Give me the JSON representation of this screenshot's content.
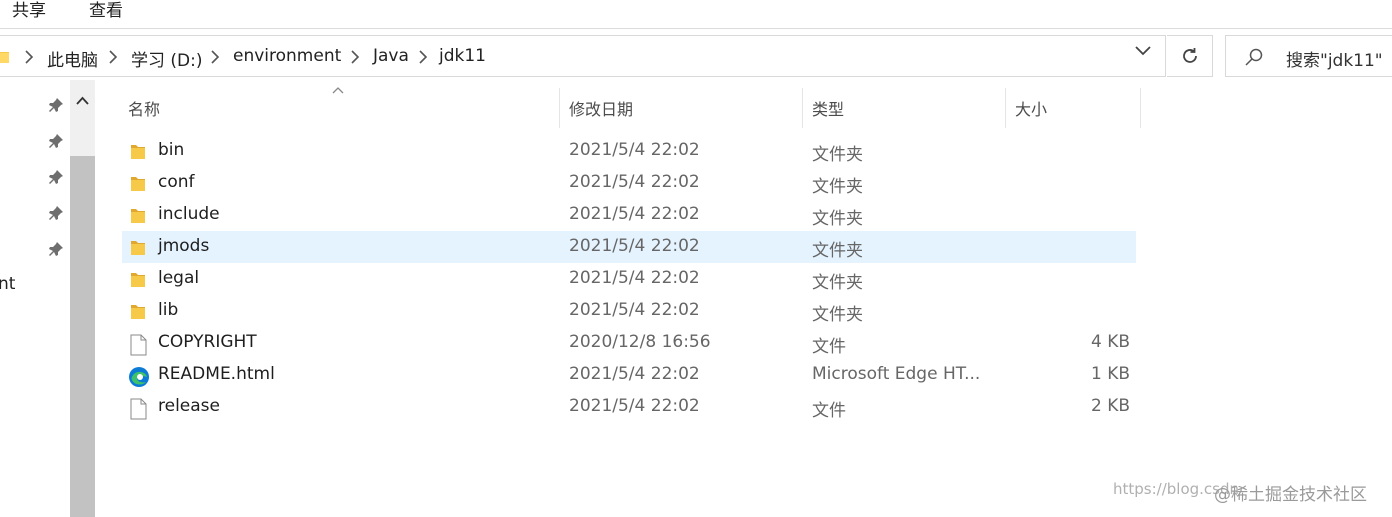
{
  "ribbon": {
    "tabs": [
      "共享",
      "查看"
    ]
  },
  "address": {
    "crumbs": [
      "此电脑",
      "学习 (D:)",
      "environment",
      "Java",
      "jdk11"
    ]
  },
  "search": {
    "placeholder": "搜索\"jdk11\""
  },
  "nav": {
    "partial_item": "nt"
  },
  "columns": {
    "name": "名称",
    "date": "修改日期",
    "type": "类型",
    "size": "大小"
  },
  "files": [
    {
      "name": "bin",
      "date": "2021/5/4 22:02",
      "type": "文件夹",
      "size": "",
      "icon": "folder-icon"
    },
    {
      "name": "conf",
      "date": "2021/5/4 22:02",
      "type": "文件夹",
      "size": "",
      "icon": "folder-icon"
    },
    {
      "name": "include",
      "date": "2021/5/4 22:02",
      "type": "文件夹",
      "size": "",
      "icon": "folder-icon"
    },
    {
      "name": "jmods",
      "date": "2021/5/4 22:02",
      "type": "文件夹",
      "size": "",
      "icon": "folder-icon",
      "selected": true
    },
    {
      "name": "legal",
      "date": "2021/5/4 22:02",
      "type": "文件夹",
      "size": "",
      "icon": "folder-icon"
    },
    {
      "name": "lib",
      "date": "2021/5/4 22:02",
      "type": "文件夹",
      "size": "",
      "icon": "folder-icon"
    },
    {
      "name": "COPYRIGHT",
      "date": "2020/12/8 16:56",
      "type": "文件",
      "size": "4 KB",
      "icon": "file-icon"
    },
    {
      "name": "README.html",
      "date": "2021/5/4 22:02",
      "type": "Microsoft Edge HT...",
      "size": "1 KB",
      "icon": "edge-icon"
    },
    {
      "name": "release",
      "date": "2021/5/4 22:02",
      "type": "文件",
      "size": "2 KB",
      "icon": "file-icon"
    }
  ],
  "watermark": {
    "url": "https://blog.csdn",
    "text": "@稀土掘金技术社区"
  },
  "colors": {
    "selection": "#e5f3ff",
    "folder": "#f7c948",
    "folder_dark": "#e0a82e",
    "edge_blue": "#0c7bd6",
    "edge_green": "#3fc06b"
  }
}
